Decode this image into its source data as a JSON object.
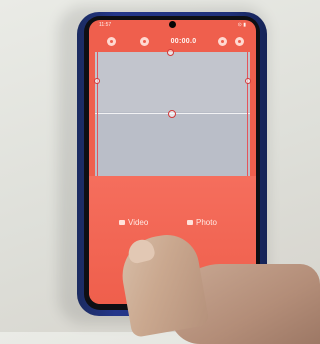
{
  "status_bar": {
    "left": "11:57",
    "right": "⊙ ▮"
  },
  "toolbar": {
    "left_buttons": [
      "settings-icon",
      "flash-icon"
    ],
    "timer": "00:00.0",
    "right_buttons": [
      "grid-icon",
      "close-icon"
    ]
  },
  "modes": {
    "video_label": "Video",
    "photo_label": "Photo"
  },
  "colors": {
    "accent": "#ef5f4d",
    "phone_case": "#24368a",
    "preview_gray": "#b8bcc6"
  }
}
